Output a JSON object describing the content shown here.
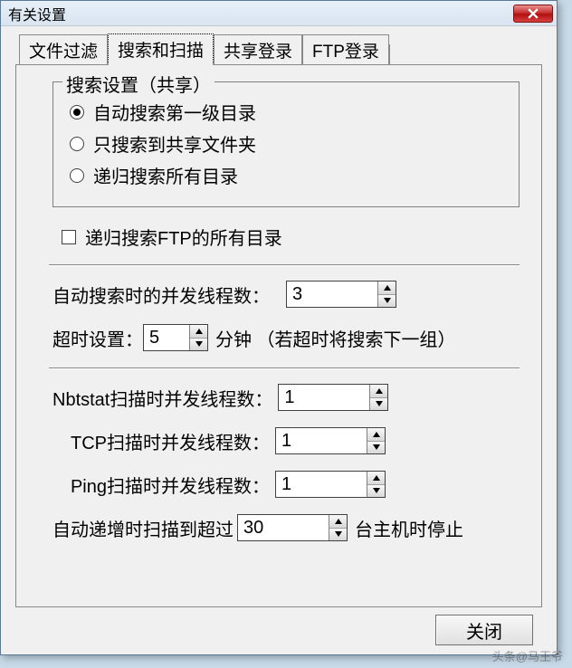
{
  "window": {
    "title": "有关设置"
  },
  "tabs": {
    "t0": "文件过滤",
    "t1": "搜索和扫描",
    "t2": "共享登录",
    "t3": "FTP登录"
  },
  "group": {
    "legend": "搜索设置（共享）",
    "r0": "自动搜索第一级目录",
    "r1": "只搜索到共享文件夹",
    "r2": "递归搜索所有目录"
  },
  "chk_ftp": "递归搜索FTP的所有目录",
  "row_threads": {
    "label": "自动搜索时的并发线程数：",
    "value": "3"
  },
  "row_timeout": {
    "label": "超时设置：",
    "value": "5",
    "suffix": "分钟 （若超时将搜索下一组）"
  },
  "row_nbt": {
    "label": "Nbtstat扫描时并发线程数：",
    "value": "1"
  },
  "row_tcp": {
    "label": "TCP扫描时并发线程数：",
    "value": "1"
  },
  "row_ping": {
    "label": "Ping扫描时并发线程数：",
    "value": "1"
  },
  "row_auto": {
    "prefix": "自动递增时扫描到超过",
    "value": "30",
    "suffix": "台主机时停止"
  },
  "footer": {
    "close": "关闭"
  },
  "watermark": "头条@马王爷"
}
